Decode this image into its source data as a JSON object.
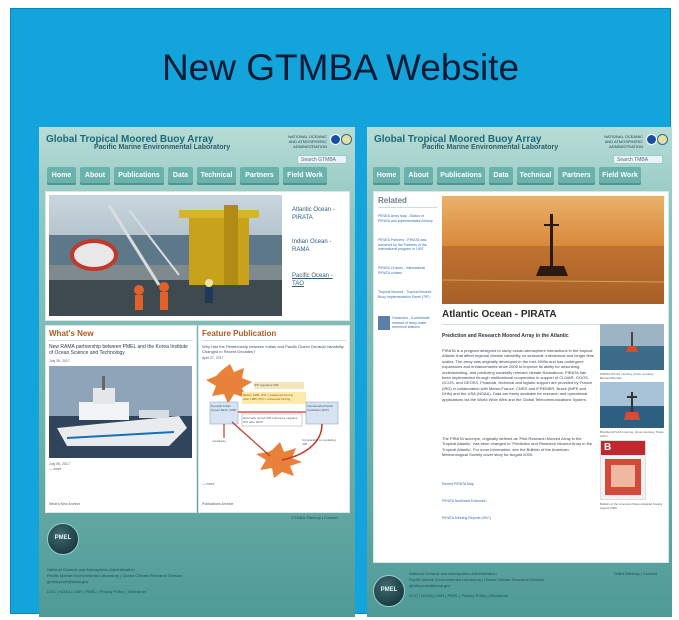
{
  "slide_title": "New GTMBA Website",
  "left": {
    "site_title": "Global Tropical Moored Buoy Array",
    "site_subtitle": "Pacific Marine Environmental Laboratory",
    "noaa_text": "NATIONAL OCEANIC AND ATMOSPHERIC ADMINISTRATION",
    "search_placeholder": "Search GTMBA",
    "nav": [
      "Home",
      "About",
      "Publications",
      "Data",
      "Technical",
      "Partners",
      "Field Work"
    ],
    "regions": [
      "Atlantic Ocean - PIRATA",
      "Indian Ocean - RAMA",
      "Pacific Ocean - TAO"
    ],
    "whats_new": {
      "heading": "What's New",
      "headline": "New RAMA partnership between PMEL and the Korea Institute of Ocean Science and Technology",
      "date_top": "July 26, 2017",
      "date_bottom": "July 05, 2017",
      "more": "— more",
      "archive": "What's New Archive"
    },
    "feature": {
      "heading": "Feature Publication",
      "headline": "Why Has the Relationship between Indian and Pacific Ocean Decadal Variability Changed in Recent Decades?",
      "date": "April 07, 2017",
      "diagram": {
        "node_top": "IPO regulates IOB",
        "node_mid": "Before 1985, IPO = weakened forcing\nAfter 1985, IPO = enhanced forcing",
        "node_left": "Decadal Indian Ocean Basin (IOB)",
        "node_right": "Interdecadal Pacific Oscillation (IPO)",
        "node_center": "Externally forced IOB enhances negative IPO after 2000",
        "label_mod": "modulates",
        "label_comp": "Comparable to regulating IOB"
      },
      "more": "— more",
      "archive": "Publications Archive"
    },
    "footer_links": "GTMBA Sitemap | Contact",
    "footer_lines": [
      "National Oceanic and Atmospheric Administration",
      "Pacific Marine Environmental Laboratory | Ocean Climate Research Division",
      "gtmba.pmel@noaa.gov",
      "DOC | NOAA | OAR | PMEL | Privacy Policy | Disclaimer"
    ],
    "pmel_logo": "PMEL"
  },
  "right": {
    "site_title": "Global Tropical Moored Buoy Array",
    "site_subtitle": "Pacific Marine Environmental Laboratory",
    "noaa_text": "NATIONAL OCEANIC AND ATMOSPHERIC ADMINISTRATION",
    "search_placeholder": "Search TMBA",
    "nav": [
      "Home",
      "About",
      "Publications",
      "Data",
      "Technical",
      "Partners",
      "Field Work"
    ],
    "related": {
      "heading": "Related",
      "items": [
        "PIRATA Array Map - Status of PIRATA and implementation history",
        "PIRATA Partners - PIRATA was launched by the Partners of the international program in 1997",
        "PIRATA Cruises - International PIRATA cruises",
        "Tropical Moored - Tropical Moored Buoy Implementation Panel (TIP)",
        "Oceanobs - A worldwide network of deep-water reference stations"
      ]
    },
    "page_title": "Atlantic Ocean - PIRATA",
    "subtitle": "Prediction and Research Moored Array in the Atlantic",
    "body_1": "PIRATA is a program designed to study ocean-atmosphere interactions in the tropical Atlantic that affect regional climate variability on seasonal, interannual and longer time scales. The array was originally developed in the mid-1990s and has undergone expansions and enhancements since 2005 to improve its ability for describing, understanding, and predicting societally relevant climate fluctuations. PIRATA has been implemented through multinational cooperation in support of CLIVAR, GOOS, GCOS, and GEOSS. Financial, technical and logistic support are provided by France (IRD) in collaboration with Meteo-France, CNRS and IFREMER, Brazil (INPE and DHN) and the USA (NOAA). Data are freely available for research and operational applications via the World Wide Web and the Global Telecommunications System.",
    "body_2": "The PIRATA acronym, originally defined as 'Pilot Research Moored Array in the Tropical Atlantic,' has been changed to 'Prediction and Research Moored Array in the Tropical Atlantic'. For more information, see the Bulletin of the American Meteorological Society cover story for August 2009.",
    "links": [
      "Recent PIRATA Map",
      "PIRATA Northeast Extension",
      "PIRATA Meeting Reports (SSC)"
    ],
    "captions": [
      "PIRATA ATLAS mooring, photo courtesy: Bernard Bourlès",
      "Brazilian ATLAS mooring, photo courtesy: Paulo Arlino",
      "Bulletin of the American Meteorological Society August 2009"
    ],
    "magazine_letter": "B",
    "footer_links": "TMBA Sitemap | Contact",
    "footer_lines": [
      "National Oceanic and Atmospheric Administration",
      "Pacific Marine Environmental Laboratory | Ocean Climate Research Division",
      "gtmba.pmel@noaa.gov",
      "DOC | NOAA | OAR | PMEL | Privacy Policy | Disclaimer"
    ],
    "pmel_logo": "PMEL"
  }
}
